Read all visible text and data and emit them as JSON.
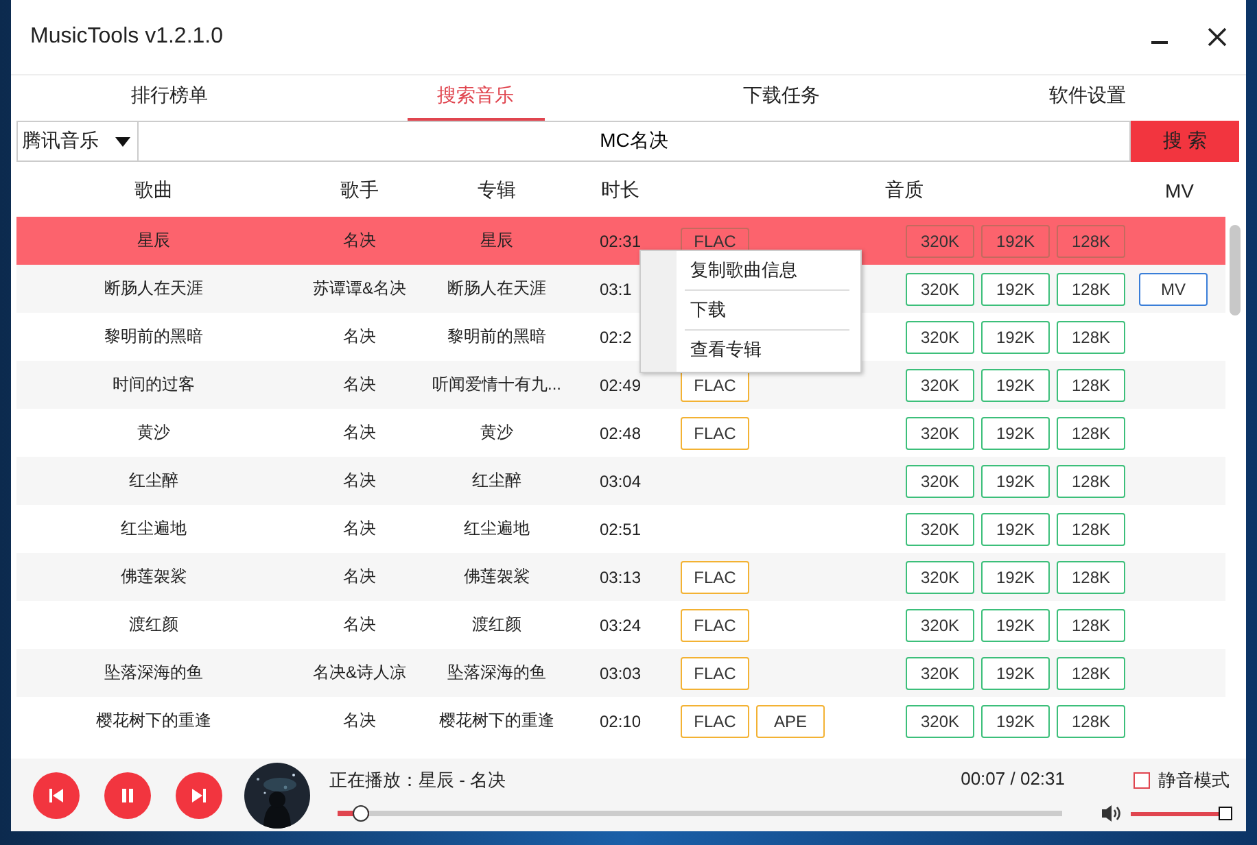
{
  "window": {
    "title": "MusicTools v1.2.1.0"
  },
  "tabs": [
    {
      "label": "排行榜单",
      "selected": false
    },
    {
      "label": "搜索音乐",
      "selected": true
    },
    {
      "label": "下载任务",
      "selected": false
    },
    {
      "label": "软件设置",
      "selected": false
    }
  ],
  "search": {
    "source": "腾讯音乐",
    "value": "MC名决",
    "button": "搜 索"
  },
  "table": {
    "columns": [
      "歌曲",
      "歌手",
      "专辑",
      "时长",
      "音质",
      "MV"
    ],
    "rows": [
      {
        "song": "星辰",
        "artist": "名决",
        "album": "星辰",
        "duration": "02:31",
        "formats": [
          "FLAC"
        ],
        "bitrates": [
          "320K",
          "192K",
          "128K"
        ],
        "selected": true
      },
      {
        "song": "断肠人在天涯",
        "artist": "苏谭谭&名决",
        "album": "断肠人在天涯",
        "duration": "03:1",
        "formats": [],
        "bitrates": [
          "320K",
          "192K",
          "128K"
        ],
        "mv": "MV",
        "selected": false
      },
      {
        "song": "黎明前的黑暗",
        "artist": "名决",
        "album": "黎明前的黑暗",
        "duration": "02:2",
        "formats": [],
        "bitrates": [
          "320K",
          "192K",
          "128K"
        ],
        "selected": false
      },
      {
        "song": "时间的过客",
        "artist": "名决",
        "album": "听闻爱情十有九...",
        "duration": "02:49",
        "formats": [
          "FLAC"
        ],
        "bitrates": [
          "320K",
          "192K",
          "128K"
        ],
        "selected": false
      },
      {
        "song": "黄沙",
        "artist": "名决",
        "album": "黄沙",
        "duration": "02:48",
        "formats": [
          "FLAC"
        ],
        "bitrates": [
          "320K",
          "192K",
          "128K"
        ],
        "selected": false
      },
      {
        "song": "红尘醉",
        "artist": "名决",
        "album": "红尘醉",
        "duration": "03:04",
        "formats": [],
        "bitrates": [
          "320K",
          "192K",
          "128K"
        ],
        "selected": false
      },
      {
        "song": "红尘遍地",
        "artist": "名决",
        "album": "红尘遍地",
        "duration": "02:51",
        "formats": [],
        "bitrates": [
          "320K",
          "192K",
          "128K"
        ],
        "selected": false
      },
      {
        "song": "佛莲袈裟",
        "artist": "名决",
        "album": "佛莲袈裟",
        "duration": "03:13",
        "formats": [
          "FLAC"
        ],
        "bitrates": [
          "320K",
          "192K",
          "128K"
        ],
        "selected": false
      },
      {
        "song": "渡红颜",
        "artist": "名决",
        "album": "渡红颜",
        "duration": "03:24",
        "formats": [
          "FLAC"
        ],
        "bitrates": [
          "320K",
          "192K",
          "128K"
        ],
        "selected": false
      },
      {
        "song": "坠落深海的鱼",
        "artist": "名决&诗人凉",
        "album": "坠落深海的鱼",
        "duration": "03:03",
        "formats": [
          "FLAC"
        ],
        "bitrates": [
          "320K",
          "192K",
          "128K"
        ],
        "selected": false
      },
      {
        "song": "樱花树下的重逢",
        "artist": "名决",
        "album": "樱花树下的重逢",
        "duration": "02:10",
        "formats": [
          "FLAC",
          "APE"
        ],
        "bitrates": [
          "320K",
          "192K",
          "128K"
        ],
        "selected": false
      }
    ]
  },
  "context_menu": {
    "items": [
      "复制歌曲信息",
      "下载",
      "查看专辑"
    ]
  },
  "player": {
    "now_playing": "正在播放：星辰 - 名决",
    "time": "00:07 / 02:31",
    "progress": {
      "level": 0.043
    },
    "volume": {
      "level": 1.0
    },
    "mute": {
      "label": "静音模式",
      "checked": false
    }
  }
}
